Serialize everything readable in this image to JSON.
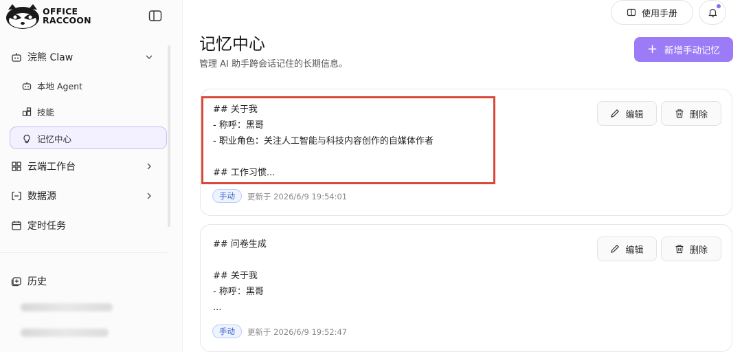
{
  "brand": {
    "line1": "OFFICE",
    "line2": "RACCOON"
  },
  "sidebar": {
    "groups": [
      {
        "label": "浣熊 Claw",
        "icon": "robot-icon"
      },
      {
        "label": "云端工作台",
        "icon": "grid-icon"
      },
      {
        "label": "数据源",
        "icon": "database-icon"
      },
      {
        "label": "定时任务",
        "icon": "calendar-icon"
      }
    ],
    "sub_items": [
      {
        "label": "本地 Agent",
        "icon": "agent-icon"
      },
      {
        "label": "技能",
        "icon": "skills-icon"
      },
      {
        "label": "记忆中心",
        "icon": "bulb-icon",
        "active": true
      }
    ],
    "history_label": "历史"
  },
  "header": {
    "manual_label": "使用手册"
  },
  "page": {
    "title": "记忆中心",
    "description": "管理 AI 助手跨会话记住的长期信息。",
    "add_button": "新增手动记忆"
  },
  "memories": [
    {
      "content": "## 关于我\n- 称呼：黑哥\n- 职业角色：关注人工智能与科技内容创作的自媒体作者\n\n## 工作习惯...",
      "tag": "手动",
      "updated": "更新于 2026/6/9 19:54:01",
      "edit_label": "编辑",
      "delete_label": "删除"
    },
    {
      "content": "## 问卷生成\n\n## 关于我\n- 称呼：黑哥\n...",
      "tag": "手动",
      "updated": "更新于 2026/6/9 19:52:47",
      "edit_label": "编辑",
      "delete_label": "删除"
    }
  ],
  "colors": {
    "accent": "#9b7cf6",
    "highlight": "#d9473a",
    "tag_blue": "#3a66c8"
  }
}
